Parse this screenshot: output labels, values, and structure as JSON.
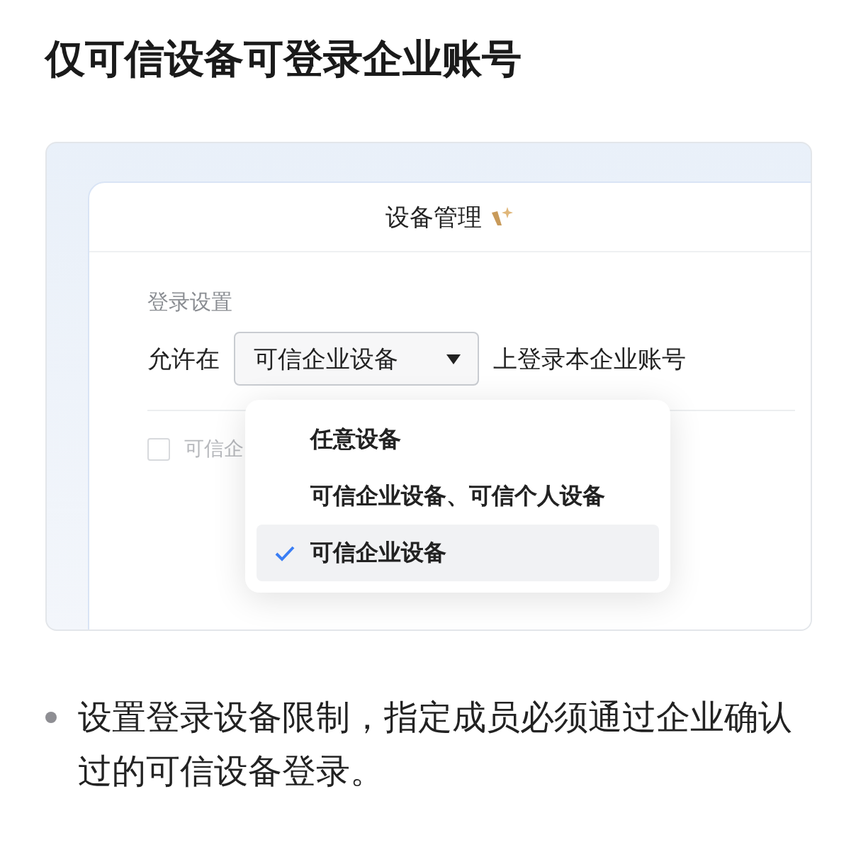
{
  "heading": "仅可信设备可登录企业账号",
  "preview": {
    "card_title": "设备管理",
    "section_label": "登录设置",
    "allow_prefix": "允许在",
    "select": {
      "value": "可信企业设备",
      "expanded": true
    },
    "allow_suffix": "上登录本企业账号",
    "option_row": {
      "label": "可信企",
      "checked": false
    },
    "dropdown": [
      {
        "label": "任意设备",
        "selected": false
      },
      {
        "label": "可信企业设备、可信个人设备",
        "selected": false
      },
      {
        "label": "可信企业设备",
        "selected": true
      }
    ]
  },
  "bullets": [
    "设置登录设备限制，指定成员必须通过企业确认过的可信设备登录。"
  ]
}
